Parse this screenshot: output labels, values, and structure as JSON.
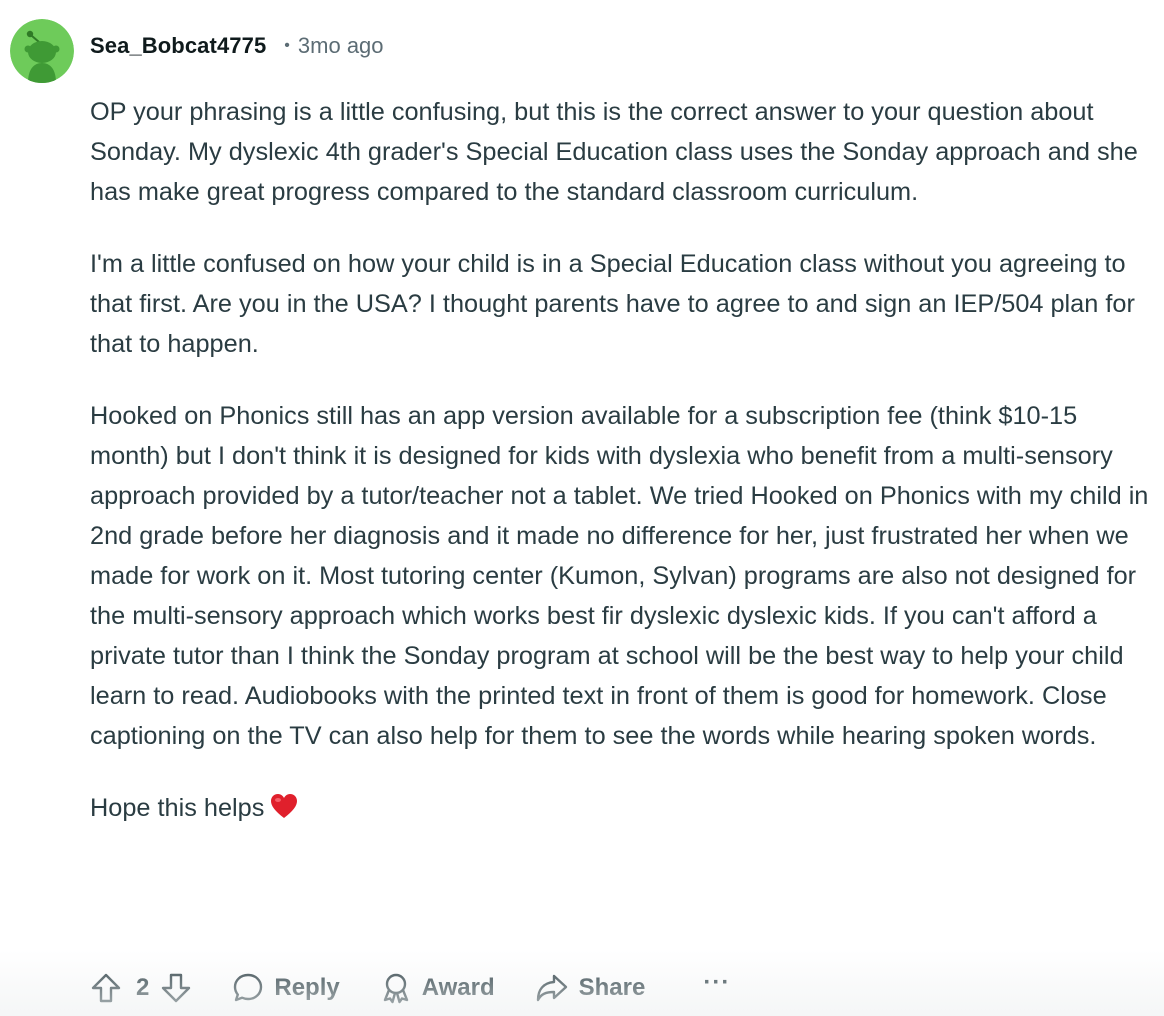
{
  "comment": {
    "author": "Sea_Bobcat4775",
    "separator": "•",
    "time_ago": "3mo ago",
    "avatar_color": "#6ecb5a",
    "paragraphs": [
      "OP your phrasing is a little confusing, but this is the correct answer to your question about Sonday. My dyslexic 4th grader's Special Education class uses the Sonday approach and she has make great progress compared to the standard classroom curriculum.",
      "I'm a little confused on how your child is in a Special Education class without you agreeing to that first. Are you in the USA? I thought parents have to agree to and sign an IEP/504 plan for that to happen.",
      "Hooked on Phonics still has an app version available for a subscription fee (think $10-15 month) but I don't think it is designed for kids with dyslexia who benefit from a multi-sensory approach provided by a tutor/teacher not a tablet. We tried Hooked on Phonics with my child in 2nd grade before her diagnosis and it made no difference for her, just frustrated her when we made for work on it. Most tutoring center (Kumon, Sylvan) programs are also not designed for the multi-sensory approach which works best fir dyslexic dyslexic kids. If you can't afford a private tutor than I think the Sonday program at school will be the best way to help your child learn to read. Audiobooks with the printed text in front of them is good for homework. Close captioning on the TV can also help for them to see the words while hearing spoken words.",
      "Hope this helps"
    ],
    "heart_emoji": "heart-icon"
  },
  "actions": {
    "upvote_icon": "upvote-icon",
    "score": "2",
    "downvote_icon": "downvote-icon",
    "reply_label": "Reply",
    "award_label": "Award",
    "share_label": "Share",
    "more_label": "···"
  },
  "colors": {
    "heart": "#e0202c",
    "text": "#2a3c42",
    "meta": "#5c6c74"
  }
}
